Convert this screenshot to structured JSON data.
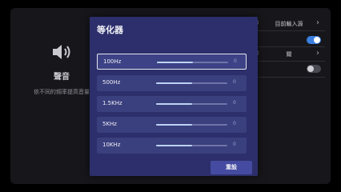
{
  "background": {
    "sound_title": "聲音",
    "sound_desc": "依不同的頻率提高音量",
    "rows": [
      {
        "type": "select",
        "value": "目前輸入源",
        "chev_left": "‹",
        "chev_right": "›"
      },
      {
        "type": "toggle",
        "state": "on"
      },
      {
        "type": "select",
        "value": "關",
        "chev_left": "‹",
        "chev_right": "›"
      },
      {
        "type": "toggle",
        "state": "off"
      }
    ]
  },
  "dialog": {
    "title": "等化器",
    "bands": [
      {
        "label": "100Hz",
        "value": "0",
        "level": 0.5,
        "selected": true
      },
      {
        "label": "500Hz",
        "value": "0",
        "level": 0.5,
        "selected": false
      },
      {
        "label": "1.5KHz",
        "value": "0",
        "level": 0.5,
        "selected": false
      },
      {
        "label": "5KHz",
        "value": "0",
        "level": 0.5,
        "selected": false
      },
      {
        "label": "10KHz",
        "value": "0",
        "level": 0.5,
        "selected": false
      }
    ],
    "reset_label": "重設"
  },
  "colors": {
    "dialog": "#2c2f6b",
    "band": "#3a3f7e",
    "toggle_on": "#3b7fe0",
    "reset": "#454ba0"
  }
}
